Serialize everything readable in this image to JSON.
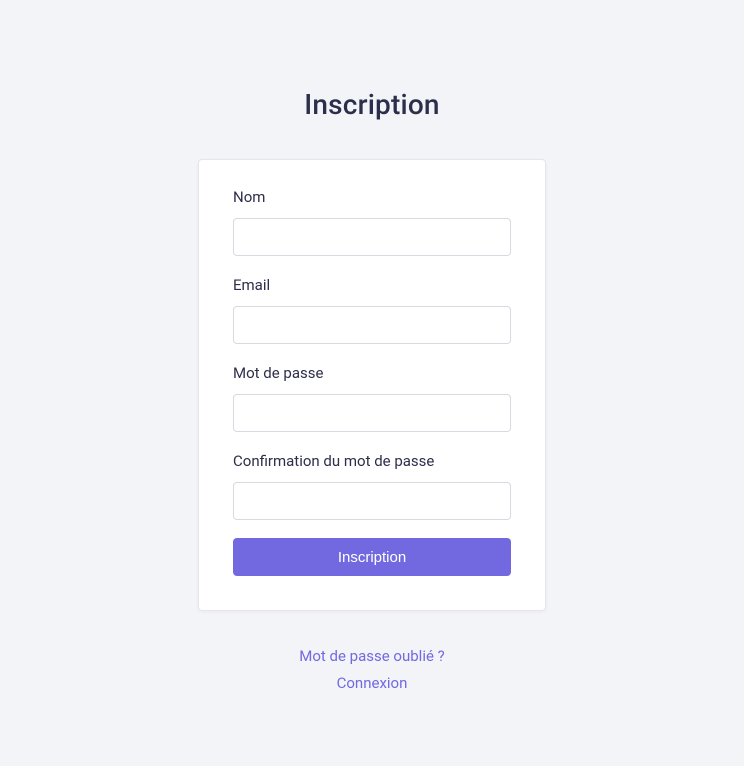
{
  "title": "Inscription",
  "form": {
    "fields": {
      "name": {
        "label": "Nom",
        "value": ""
      },
      "email": {
        "label": "Email",
        "value": ""
      },
      "password": {
        "label": "Mot de passe",
        "value": ""
      },
      "password_confirmation": {
        "label": "Confirmation du mot de passe",
        "value": ""
      }
    },
    "submit_label": "Inscription"
  },
  "links": {
    "forgot_password": "Mot de passe oublié ?",
    "login": "Connexion"
  },
  "colors": {
    "background": "#f3f4f8",
    "primary": "#7269e0",
    "text": "#2d2e4a",
    "border": "#d9dae1",
    "card_bg": "#ffffff"
  }
}
